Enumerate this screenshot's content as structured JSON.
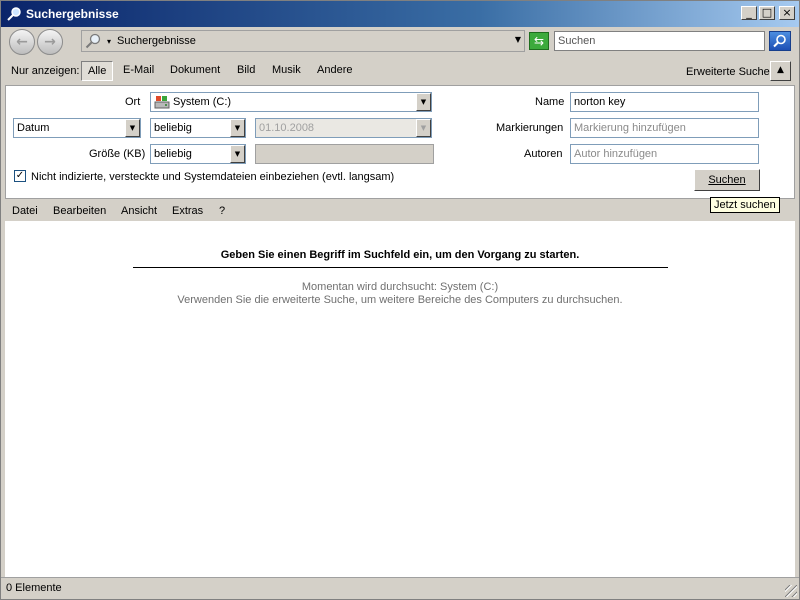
{
  "window": {
    "title": "Suchergebnisse",
    "controls": [
      "_",
      "□",
      "×"
    ]
  },
  "navbar": {
    "back_glyph": "←",
    "forward_glyph": "→",
    "address": "Suchergebnisse",
    "address_caret": "▾",
    "address_dropdown": "▼",
    "refresh_glyph": "⇆",
    "search_placeholder": "Suchen"
  },
  "filterbar": {
    "label": "Nur anzeigen:",
    "filters": [
      "Alle",
      "E-Mail",
      "Dokument",
      "Bild",
      "Musik",
      "Andere"
    ],
    "active_filter": "Alle",
    "advanced_label": "Erweiterte Suche",
    "collapse_glyph": "▲"
  },
  "advanced": {
    "location_label": "Ort",
    "location_value": "System (C:)",
    "date_field": "Datum",
    "date_mode": "beliebig",
    "date_value": "01.10.2008",
    "size_label": "Größe (KB)",
    "size_mode": "beliebig",
    "size_value": "",
    "name_label": "Name",
    "name_value": "norton key",
    "tags_label": "Markierungen",
    "tags_placeholder": "Markierung hinzufügen",
    "authors_label": "Autoren",
    "authors_placeholder": "Autor hinzufügen",
    "include_checkbox_label": "Nicht indizierte, versteckte und Systemdateien einbeziehen (evtl. langsam)",
    "include_checked": true,
    "search_button": "Suchen"
  },
  "tooltip": "Jetzt suchen",
  "menu": [
    "Datei",
    "Bearbeiten",
    "Ansicht",
    "Extras",
    "?"
  ],
  "content": {
    "prompt": "Geben Sie einen Begriff im Suchfeld ein, um den Vorgang zu starten.",
    "info_line1": "Momentan wird durchsucht: System (C:)",
    "info_line2": "Verwenden Sie die erweiterte Suche, um weitere Bereiche des Computers zu durchsuchen."
  },
  "status": {
    "text": "0 Elemente"
  },
  "icons": {
    "app": "magnifier-icon",
    "drive": "drive-icon",
    "search_go": "search-icon"
  }
}
